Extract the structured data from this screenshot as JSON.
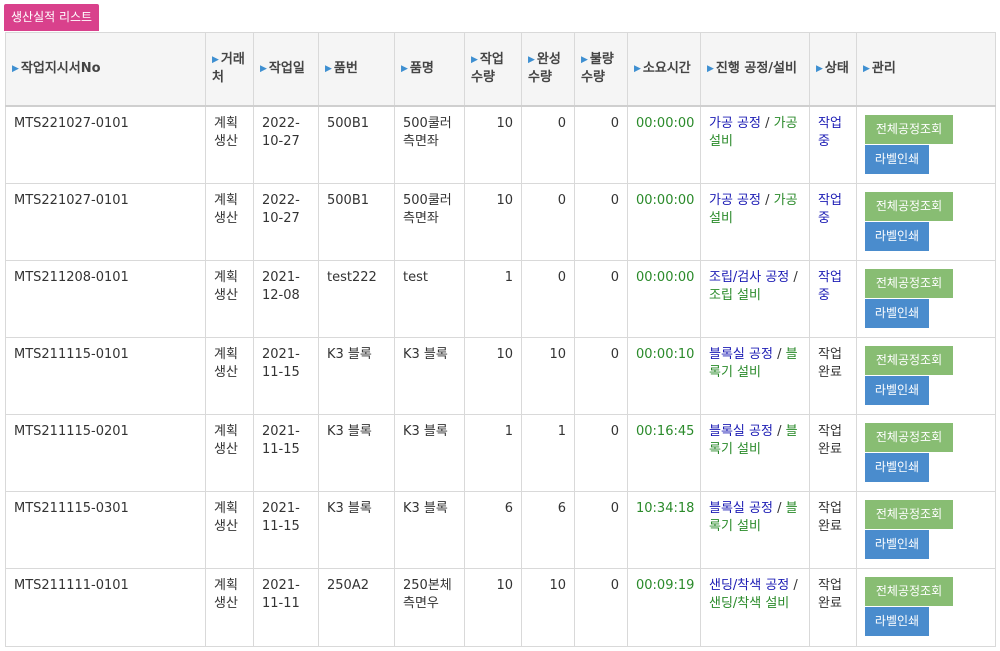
{
  "tab_label": "생산실적 리스트",
  "columns": [
    "작업지시서No",
    "거래처",
    "작업일",
    "품번",
    "품명",
    "작업수량",
    "완성수량",
    "불량수량",
    "소요시간",
    "진행 공정/설비",
    "상태",
    "관리"
  ],
  "buttons": {
    "view_all_process": "전체공정조회",
    "print_label": "라벨인쇄"
  },
  "rows": [
    {
      "order_no": "MTS221027-0101",
      "client": "계획생산",
      "date": "2022-10-27",
      "part_no": "500B1",
      "part_name": "500쿨러 측면좌",
      "work_qty": "10",
      "done_qty": "0",
      "defect_qty": "0",
      "elapsed": "00:00:00",
      "process": "가공 공정",
      "equipment": "가공 설비",
      "status": "작업중",
      "status_color": "#1c1cb4"
    },
    {
      "order_no": "MTS221027-0101",
      "client": "계획생산",
      "date": "2022-10-27",
      "part_no": "500B1",
      "part_name": "500쿨러 측면좌",
      "work_qty": "10",
      "done_qty": "0",
      "defect_qty": "0",
      "elapsed": "00:00:00",
      "process": "가공 공정",
      "equipment": "가공 설비",
      "status": "작업중",
      "status_color": "#1c1cb4"
    },
    {
      "order_no": "MTS211208-0101",
      "client": "계획생산",
      "date": "2021-12-08",
      "part_no": "test222",
      "part_name": "test",
      "work_qty": "1",
      "done_qty": "0",
      "defect_qty": "0",
      "elapsed": "00:00:00",
      "process": "조립/검사 공정",
      "equipment": "조립 설비",
      "status": "작업중",
      "status_color": "#1c1cb4"
    },
    {
      "order_no": "MTS211115-0101",
      "client": "계획생산",
      "date": "2021-11-15",
      "part_no": "K3 블록",
      "part_name": "K3 블록",
      "work_qty": "10",
      "done_qty": "10",
      "defect_qty": "0",
      "elapsed": "00:00:10",
      "process": "블록실 공정",
      "equipment": "블록기 설비",
      "status": "작업완료",
      "status_color": "#333333"
    },
    {
      "order_no": "MTS211115-0201",
      "client": "계획생산",
      "date": "2021-11-15",
      "part_no": "K3 블록",
      "part_name": "K3 블록",
      "work_qty": "1",
      "done_qty": "1",
      "defect_qty": "0",
      "elapsed": "00:16:45",
      "process": "블록실 공정",
      "equipment": "블록기 설비",
      "status": "작업완료",
      "status_color": "#333333"
    },
    {
      "order_no": "MTS211115-0301",
      "client": "계획생산",
      "date": "2021-11-15",
      "part_no": "K3 블록",
      "part_name": "K3 블록",
      "work_qty": "6",
      "done_qty": "6",
      "defect_qty": "0",
      "elapsed": "10:34:18",
      "process": "블록실 공정",
      "equipment": "블록기 설비",
      "status": "작업완료",
      "status_color": "#333333"
    },
    {
      "order_no": "MTS211111-0101",
      "client": "계획생산",
      "date": "2021-11-11",
      "part_no": "250A2",
      "part_name": "250본체 측면우",
      "work_qty": "10",
      "done_qty": "10",
      "defect_qty": "0",
      "elapsed": "00:09:19",
      "process": "샌딩/착색 공정",
      "equipment": "샌딩/착색 설비",
      "status": "작업완료",
      "status_color": "#333333"
    }
  ]
}
